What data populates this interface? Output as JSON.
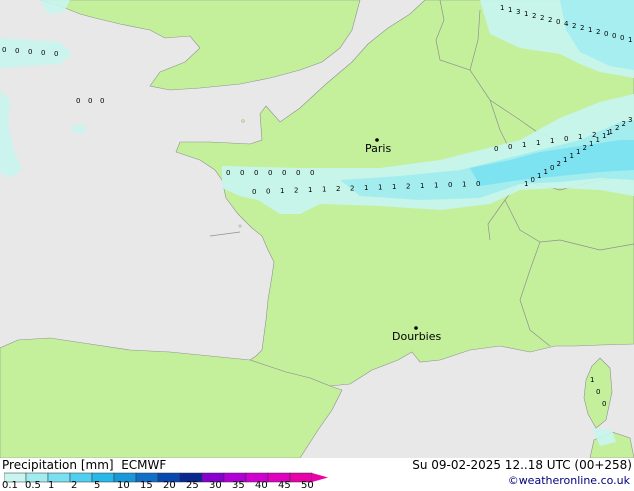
{
  "map": {
    "cities": [
      {
        "name": "Paris"
      },
      {
        "name": "Dourbies"
      }
    ],
    "precip_labels": {
      "north_sea": [
        "1",
        "1",
        "3",
        "1",
        "2",
        "2",
        "2",
        "0",
        "4",
        "2",
        "2",
        "1",
        "2",
        "0",
        "0",
        "0",
        "1",
        "0"
      ],
      "atlantic_nw": [
        "0",
        "0",
        "0",
        "0",
        "0"
      ],
      "atlantic_mid": [
        "0",
        "0",
        "0"
      ],
      "band_west": [
        "0",
        "0",
        "0",
        "0",
        "0",
        "0",
        "0"
      ],
      "band_main": [
        "0",
        "0",
        "1",
        "2",
        "1",
        "1",
        "2",
        "2",
        "1",
        "1",
        "1",
        "2",
        "1",
        "1",
        "0",
        "1",
        "0"
      ],
      "band_upper": [
        "0",
        "0",
        "1",
        "1",
        "1",
        "0",
        "1",
        "2",
        "1"
      ],
      "band_east": [
        "1",
        "0",
        "1",
        "1",
        "0",
        "2",
        "1",
        "1",
        "1",
        "2",
        "1",
        "1",
        "1",
        "1",
        "2",
        "2",
        "3",
        "3"
      ],
      "corsica": [
        "1",
        "0",
        "0"
      ]
    }
  },
  "footer": {
    "title": "Precipitation [mm]",
    "model": "ECMWF",
    "datetime": "Su 09-02-2025 12..18 UTC (00+258)",
    "credit": "©weatheronline.co.uk",
    "scale_ticks": [
      "0.1",
      "0.5",
      "1",
      "2",
      "5",
      "10",
      "15",
      "20",
      "25",
      "30",
      "35",
      "40",
      "45",
      "50"
    ],
    "scale_colors": [
      "#c8f5f0",
      "#a0ecf0",
      "#78e0f0",
      "#50d0f0",
      "#28b8e8",
      "#1898d8",
      "#1070c8",
      "#0848b0",
      "#082890",
      "#8800d0",
      "#b000d8",
      "#d000d0",
      "#e000c0",
      "#e800a8"
    ]
  }
}
